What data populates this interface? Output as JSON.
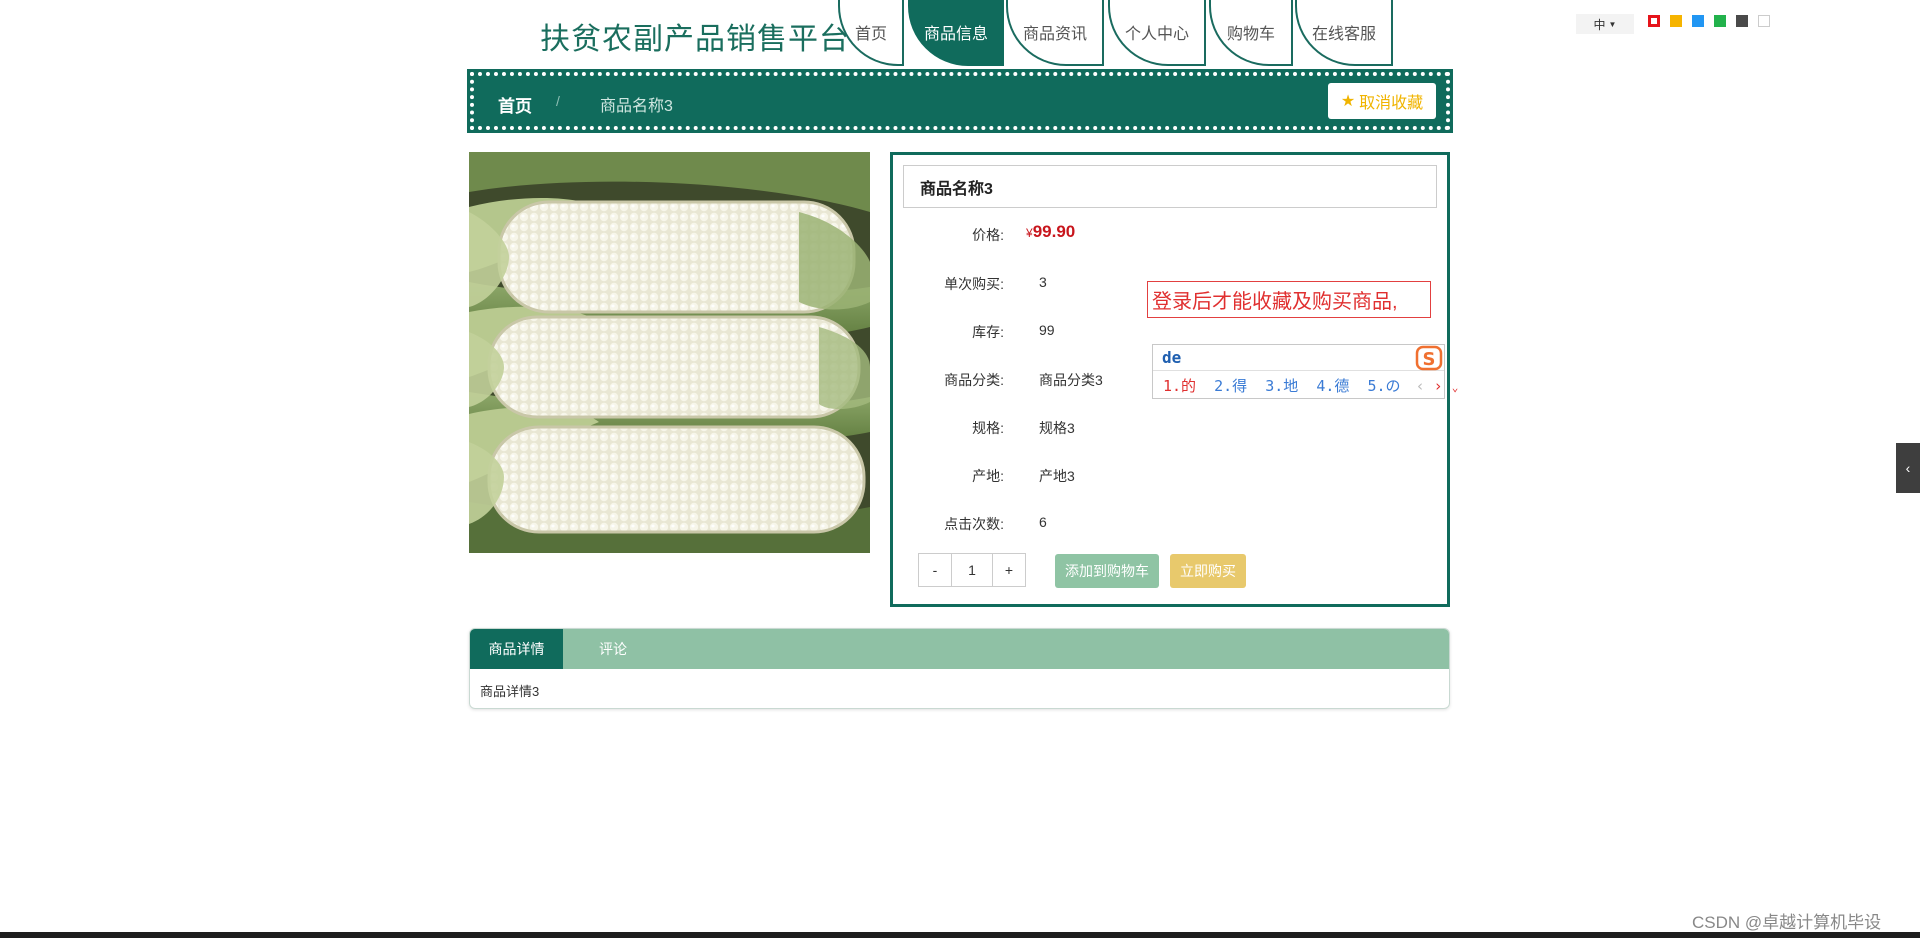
{
  "header": {
    "site_title": "扶贫农副产品销售平台",
    "nav": [
      {
        "label": "首页",
        "active": false
      },
      {
        "label": "商品信息",
        "active": true
      },
      {
        "label": "商品资讯",
        "active": false
      },
      {
        "label": "个人中心",
        "active": false
      },
      {
        "label": "购物车",
        "active": false
      },
      {
        "label": "在线客服",
        "active": false
      }
    ],
    "lang_label": "中",
    "theme_colors": [
      "#e6141b",
      "#f6b400",
      "#2196f3",
      "#22b24c",
      "#4a4a4a",
      "#ffffff"
    ]
  },
  "breadcrumb": {
    "home": "首页",
    "separator": "/",
    "current": "商品名称3",
    "favorite_button": "取消收藏"
  },
  "product": {
    "name": "商品名称3",
    "fields": [
      {
        "label": "价格:",
        "value": "99.90",
        "currency": "¥"
      },
      {
        "label": "单次购买:",
        "value": "3"
      },
      {
        "label": "库存:",
        "value": "99"
      },
      {
        "label": "商品分类:",
        "value": "商品分类3"
      },
      {
        "label": "规格:",
        "value": "规格3"
      },
      {
        "label": "产地:",
        "value": "产地3"
      },
      {
        "label": "点击次数:",
        "value": "6"
      }
    ],
    "quantity": "1",
    "minus": "-",
    "plus": "+",
    "add_to_cart": "添加到购物车",
    "buy_now": "立即购买"
  },
  "notice": "登录后才能收藏及购买商品,",
  "ime": {
    "input": "de",
    "candidates": [
      "1.的",
      "2.得",
      "3.地",
      "4.德",
      "5.の"
    ]
  },
  "tabs": {
    "items": [
      "商品详情",
      "评论"
    ],
    "active_content": "商品详情3"
  },
  "watermark": "CSDN @卓越计算机毕设"
}
